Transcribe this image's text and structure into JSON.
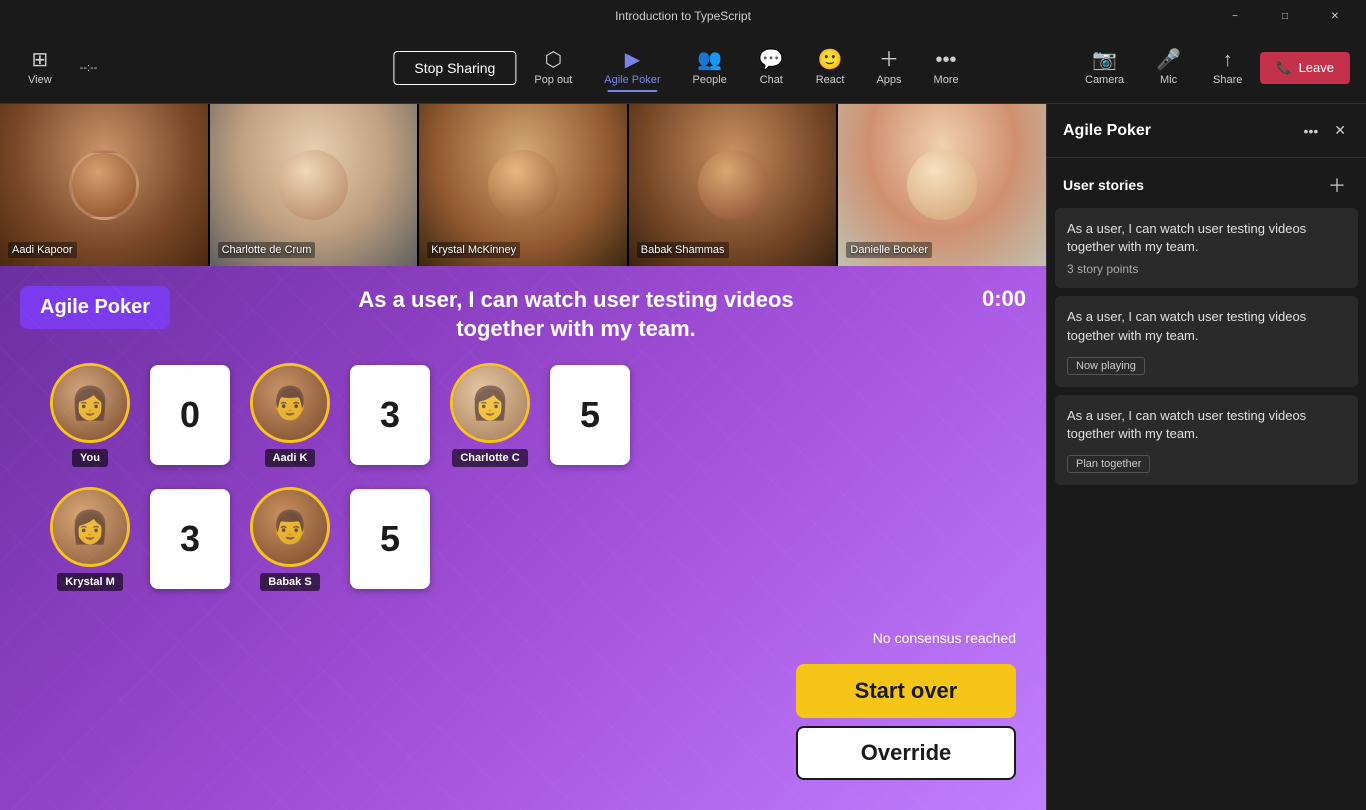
{
  "window": {
    "title": "Introduction to TypeScript",
    "minimize_label": "−",
    "maximize_label": "□",
    "close_label": "✕"
  },
  "toolbar": {
    "view_label": "View",
    "timer": "--:--",
    "stop_sharing": "Stop Sharing",
    "popout_label": "Pop out",
    "agile_poker_label": "Agile Poker",
    "people_label": "People",
    "chat_label": "Chat",
    "react_label": "React",
    "apps_label": "Apps",
    "more_label": "More",
    "camera_label": "Camera",
    "mic_label": "Mic",
    "share_label": "Share",
    "leave_label": "Leave"
  },
  "video_strip": {
    "participants": [
      {
        "name": "Aadi Kapoor",
        "face_class": "face-aadi"
      },
      {
        "name": "Charlotte de Crum",
        "face_class": "face-charlotte"
      },
      {
        "name": "Krystal McKinney",
        "face_class": "face-krystal"
      },
      {
        "name": "Babak Shammas",
        "face_class": "face-babak"
      },
      {
        "name": "Danielle Booker",
        "face_class": "face-danielle"
      }
    ]
  },
  "poker": {
    "app_name": "Agile Poker",
    "story_title": "As a user, I can watch user testing videos together with my team.",
    "timer": "0:00",
    "players": [
      {
        "name": "You",
        "card": "0",
        "face_class": "face-you-sm"
      },
      {
        "name": "Aadi K",
        "card": "3",
        "face_class": "face-aadi-sm"
      },
      {
        "name": "Charlotte C",
        "card": "5",
        "face_class": "face-charlotte-sm"
      }
    ],
    "players_row2": [
      {
        "name": "Krystal M",
        "card": "3",
        "face_class": "face-krystal-sm"
      },
      {
        "name": "Babak S",
        "card": "5",
        "face_class": "face-babak-sm"
      }
    ],
    "no_consensus": "No consensus reached",
    "start_over": "Start over",
    "override": "Override"
  },
  "panel": {
    "title": "Agile Poker",
    "section_title": "User stories",
    "stories": [
      {
        "text": "As a user, I can watch user testing videos together with my team.",
        "meta": "3 story points",
        "badge": null
      },
      {
        "text": "As a user, I can watch user testing videos together with my team.",
        "meta": null,
        "badge": "Now playing"
      },
      {
        "text": "As a user, I can watch user testing videos together with my team.",
        "meta": null,
        "badge": "Plan together"
      }
    ]
  }
}
